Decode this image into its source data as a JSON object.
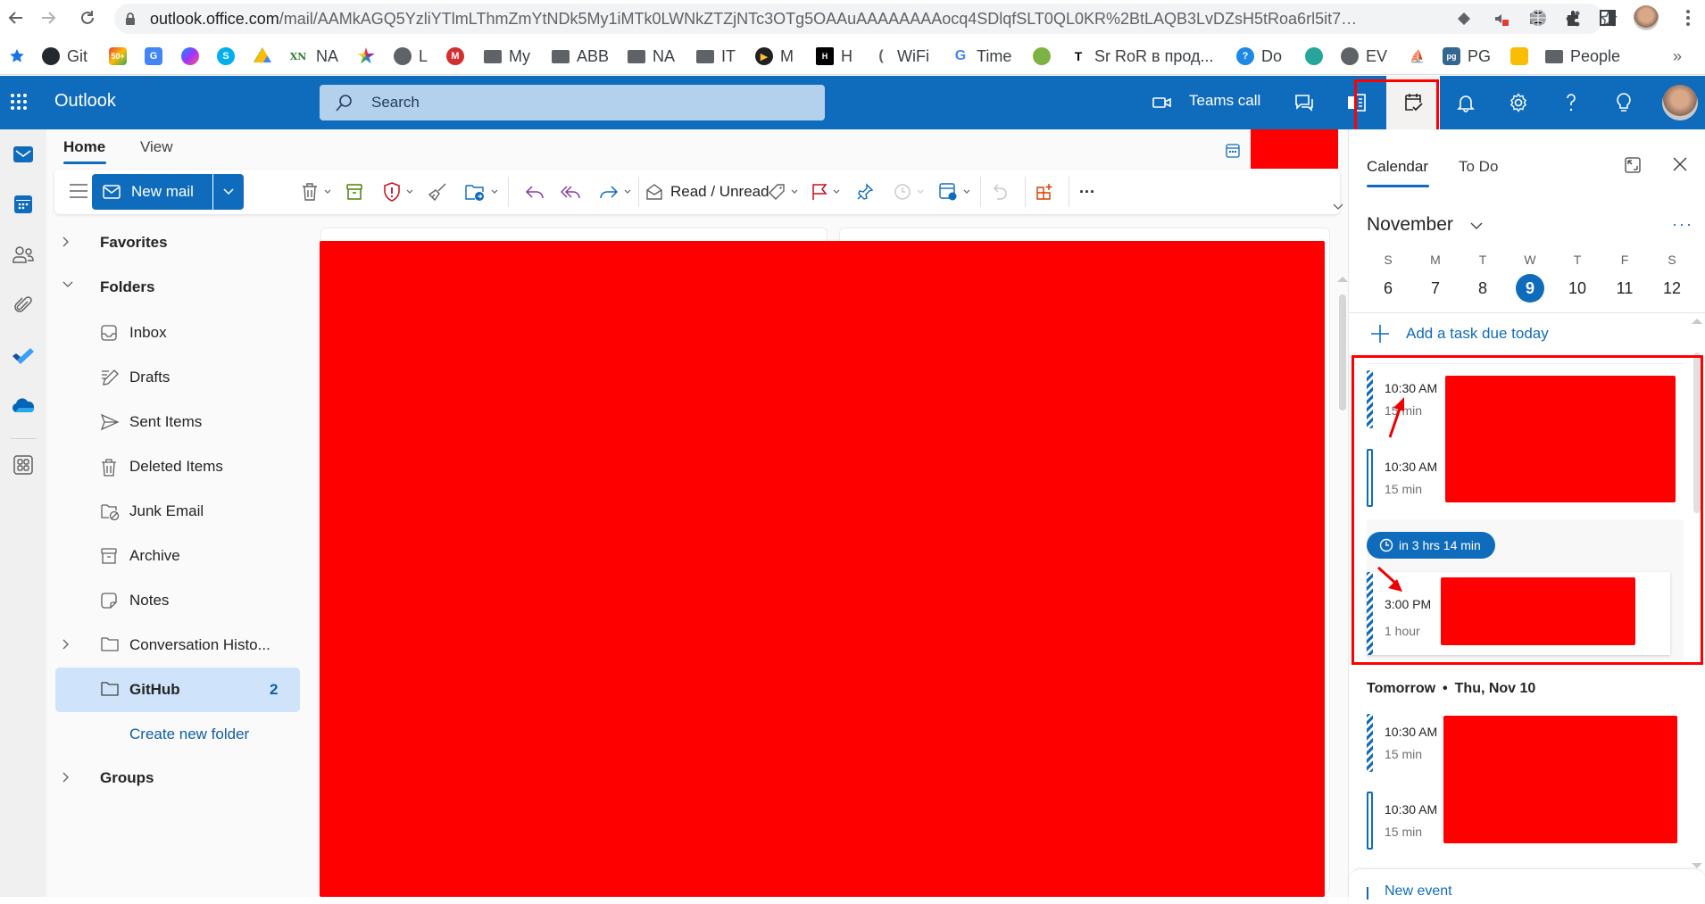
{
  "browser": {
    "url_host": "outlook.office.com",
    "url_path": "/mail/AAMkAGQ5YzliYTlmLThmZmYtNDk5My1iMTk0LWNkZTZjNTc3OTg5OAAuAAAAAAAAocq4SDlqfSLT0QL0KR%2BtLAQB3LvDZsH5tRoa6rl5it7…",
    "bookmarks": [
      {
        "icon": "github-icon",
        "label": "Git"
      },
      {
        "icon": "gmail-icon",
        "label": ""
      },
      {
        "icon": "translate-icon",
        "label": ""
      },
      {
        "icon": "messenger-icon",
        "label": ""
      },
      {
        "icon": "skype-icon",
        "label": ""
      },
      {
        "icon": "drive-icon",
        "label": ""
      },
      {
        "icon": "xn-icon",
        "label": "NA"
      },
      {
        "icon": "star-logo-icon",
        "label": ""
      },
      {
        "icon": "globe-icon",
        "label": "L"
      },
      {
        "icon": "m-red-icon",
        "label": ""
      },
      {
        "icon": "folder-icon",
        "label": "My"
      },
      {
        "icon": "folder-icon",
        "label": "ABB"
      },
      {
        "icon": "folder-icon",
        "label": "NA"
      },
      {
        "icon": "folder-icon",
        "label": "IT"
      },
      {
        "icon": "play-icon",
        "label": "M"
      },
      {
        "icon": "hh-icon",
        "label": "H"
      },
      {
        "icon": "wifi-icon",
        "label": "WiFi"
      },
      {
        "icon": "google-icon",
        "label": "Time"
      },
      {
        "icon": "green-circle-icon",
        "label": ""
      },
      {
        "icon": "t-icon",
        "label": "Sr RoR в прод..."
      },
      {
        "icon": "help-circle-icon",
        "label": "Do"
      },
      {
        "icon": "paw-icon",
        "label": ""
      },
      {
        "icon": "globe-icon",
        "label": "EV"
      },
      {
        "icon": "ship-icon",
        "label": ""
      },
      {
        "icon": "pg-icon",
        "label": "PG"
      },
      {
        "icon": "keep-icon",
        "label": ""
      },
      {
        "icon": "folder-icon",
        "label": "People"
      }
    ],
    "bookmarks_overflow": "»"
  },
  "header": {
    "app_name": "Outlook",
    "search_placeholder": "Search",
    "teams_call_label": "Teams call"
  },
  "ribbon": {
    "tabs": [
      "Home",
      "View"
    ],
    "new_mail_label": "New mail",
    "read_unread_label": "Read / Unread",
    "more_label": "···"
  },
  "folders": {
    "favorites_label": "Favorites",
    "folders_label": "Folders",
    "items": [
      {
        "label": "Inbox",
        "icon": "inbox-icon"
      },
      {
        "label": "Drafts",
        "icon": "drafts-icon"
      },
      {
        "label": "Sent Items",
        "icon": "sent-icon"
      },
      {
        "label": "Deleted Items",
        "icon": "trash-icon"
      },
      {
        "label": "Junk Email",
        "icon": "junk-icon"
      },
      {
        "label": "Archive",
        "icon": "archive-icon"
      },
      {
        "label": "Notes",
        "icon": "notes-icon"
      },
      {
        "label": "Conversation Histo...",
        "icon": "folder-icon"
      },
      {
        "label": "GitHub",
        "icon": "folder-icon",
        "count": "2",
        "selected": true
      }
    ],
    "create_new_folder": "Create new folder",
    "groups_label": "Groups"
  },
  "todo_pane": {
    "tabs": [
      "Calendar",
      "To Do"
    ],
    "active_tab": "Calendar",
    "month": "November",
    "more": "···",
    "week_days": [
      "S",
      "M",
      "T",
      "W",
      "T",
      "F",
      "S"
    ],
    "week_dates": [
      "6",
      "7",
      "8",
      "9",
      "10",
      "11",
      "12"
    ],
    "today_index": 3,
    "add_task_label": "Add a task due today",
    "today_events": [
      {
        "time": "10:30 AM",
        "duration": "15 min",
        "style": "tentative"
      },
      {
        "time": "10:30 AM",
        "duration": "15 min",
        "style": "free"
      },
      {
        "time": "3:00 PM",
        "duration": "1 hour",
        "style": "tentative"
      }
    ],
    "countdown": "in 3 hrs 14 min",
    "tomorrow_label": "Tomorrow",
    "tomorrow_date": "Thu, Nov 10",
    "tomorrow_events": [
      {
        "time": "10:30 AM",
        "duration": "15 min",
        "style": "tentative"
      },
      {
        "time": "10:30 AM",
        "duration": "15 min",
        "style": "free"
      }
    ],
    "new_event_label": "New event"
  },
  "colors": {
    "brand": "#0f6cbd",
    "selected_folder": "#cfe4fa",
    "redaction": "#ff0000"
  }
}
